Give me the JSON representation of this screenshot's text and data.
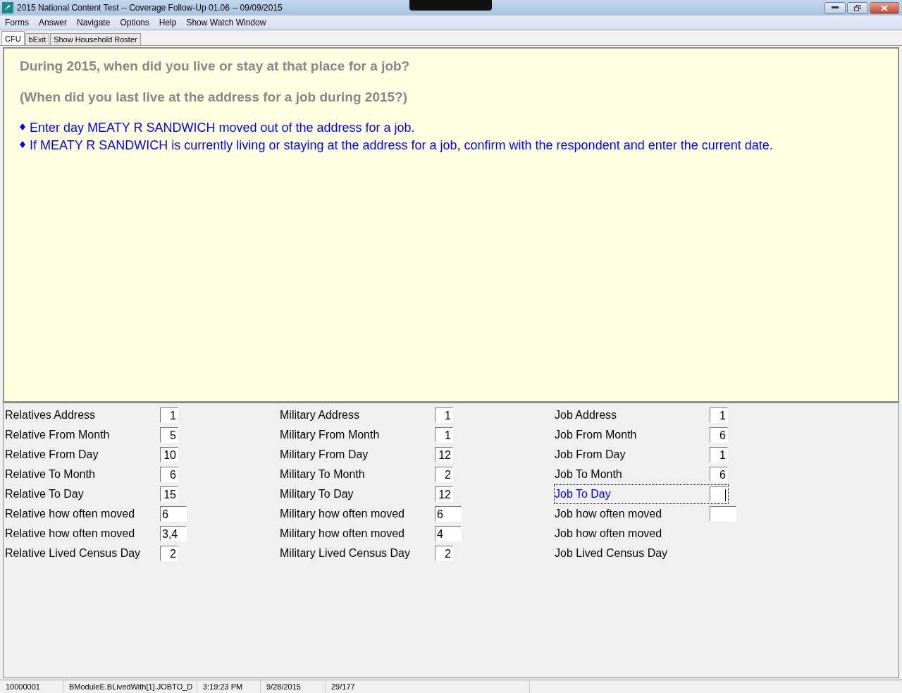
{
  "window": {
    "title": "2015 National Content Test -- Coverage Follow-Up 01.06 -- 09/09/2015"
  },
  "menu": [
    "Forms",
    "Answer",
    "Navigate",
    "Options",
    "Help",
    "Show Watch Window"
  ],
  "tabs": [
    {
      "label": "CFU",
      "selected": true
    },
    {
      "label": "bExit",
      "selected": false
    },
    {
      "label": "Show Household Roster",
      "selected": false
    }
  ],
  "question": {
    "text": "During 2015, when did you live or stay at that place for a job?",
    "alternate": "(When did you last live at the address for a job during 2015?)",
    "instructions": [
      "Enter day MEATY R SANDWICH moved out of the address for a job.",
      "If MEATY R SANDWICH is currently living or staying at the address for a job, confirm with the respondent and enter the current date."
    ]
  },
  "columns": [
    {
      "fields": [
        {
          "label": "Relatives Address",
          "value": "1",
          "kind": "short",
          "selected": false
        },
        {
          "label": "Relative From Month",
          "value": "5",
          "kind": "short",
          "selected": false
        },
        {
          "label": "Relative From Day",
          "value": "10",
          "kind": "short",
          "selected": false
        },
        {
          "label": "Relative To Month",
          "value": "6",
          "kind": "short",
          "selected": false
        },
        {
          "label": "Relative To Day",
          "value": "15",
          "kind": "short",
          "selected": false
        },
        {
          "label": "Relative how often moved",
          "value": "6",
          "kind": "wide",
          "selected": false
        },
        {
          "label": "Relative how often moved",
          "value": "3,4",
          "kind": "wide",
          "selected": false
        },
        {
          "label": "Relative Lived Census Day",
          "value": "2",
          "kind": "short",
          "selected": false
        }
      ]
    },
    {
      "fields": [
        {
          "label": "Military Address",
          "value": "1",
          "kind": "short",
          "selected": false
        },
        {
          "label": "Military From Month",
          "value": "1",
          "kind": "short",
          "selected": false
        },
        {
          "label": "Military From Day",
          "value": "12",
          "kind": "short",
          "selected": false
        },
        {
          "label": "Military To Month",
          "value": "2",
          "kind": "short",
          "selected": false
        },
        {
          "label": "Military To Day",
          "value": "12",
          "kind": "short",
          "selected": false
        },
        {
          "label": "Military how often moved",
          "value": "6",
          "kind": "wide",
          "selected": false
        },
        {
          "label": "Military how often moved",
          "value": "4",
          "kind": "wide",
          "selected": false
        },
        {
          "label": "Military Lived Census Day",
          "value": "2",
          "kind": "short",
          "selected": false
        }
      ]
    },
    {
      "fields": [
        {
          "label": "Job Address",
          "value": "1",
          "kind": "short",
          "selected": false
        },
        {
          "label": "Job From Month",
          "value": "6",
          "kind": "short",
          "selected": false
        },
        {
          "label": "Job From Day",
          "value": "1",
          "kind": "short",
          "selected": false
        },
        {
          "label": "Job To Month",
          "value": "6",
          "kind": "short",
          "selected": false
        },
        {
          "label": "Job To Day",
          "kind": "short",
          "selected": true
        },
        {
          "label": "Job how often moved",
          "kind": "wide",
          "selected": false
        },
        {
          "label": "Job how often moved",
          "kind": "none",
          "selected": false
        },
        {
          "label": "Job Lived Census Day",
          "kind": "none",
          "selected": false
        }
      ]
    }
  ],
  "status_bar": [
    "10000001",
    "BModuleE.BLivedWith[1].JOBTO_D",
    "3:19:23 PM",
    "9/28/2015",
    "29/177"
  ]
}
